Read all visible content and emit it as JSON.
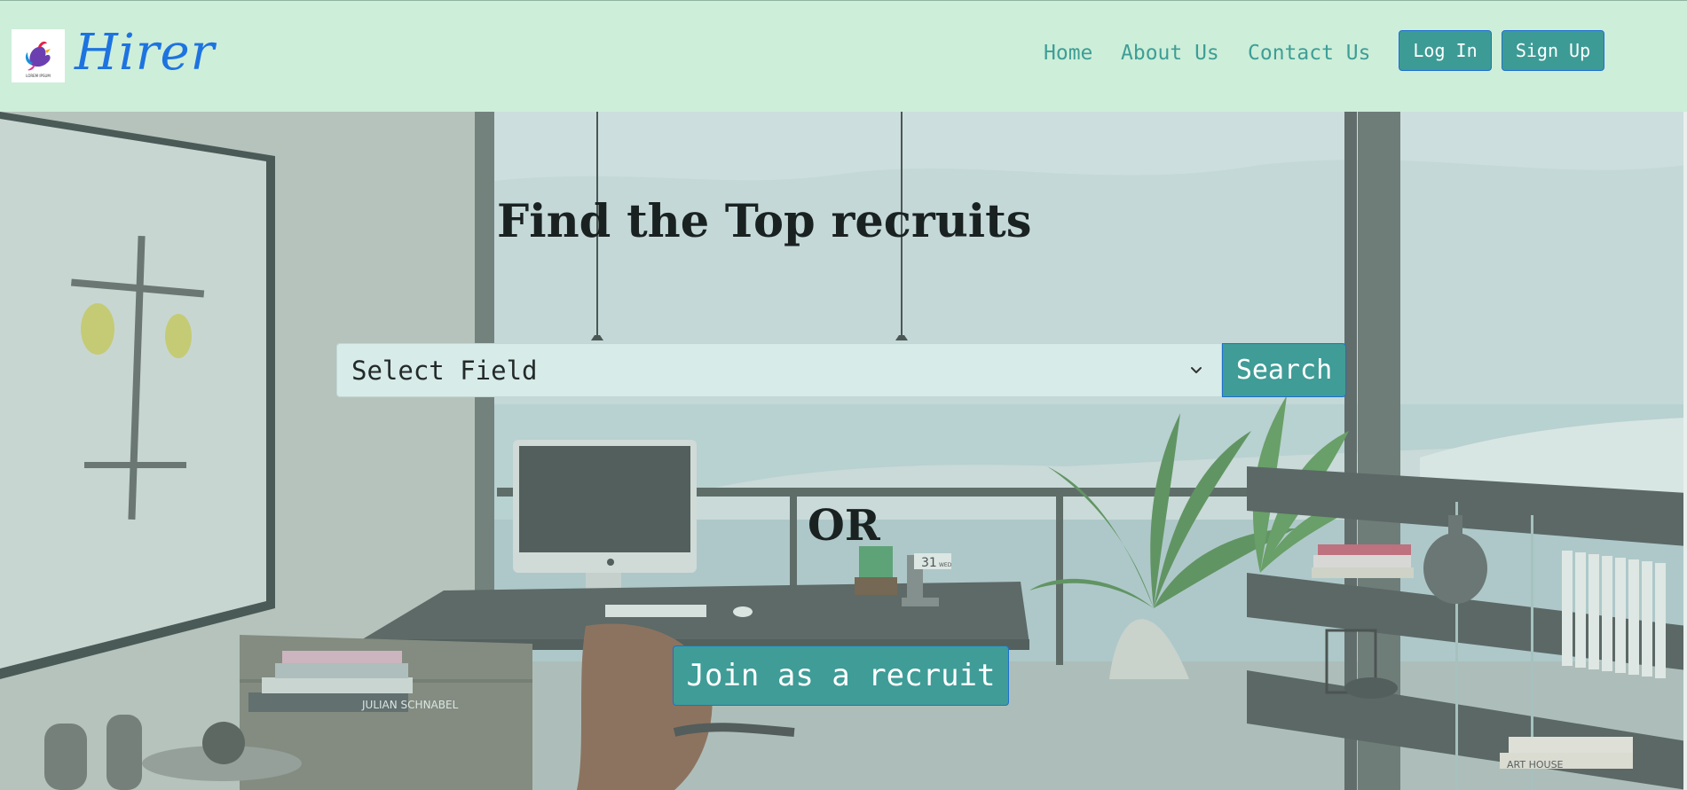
{
  "brand": {
    "name": "Hirer",
    "logo_icon": "rooster-logo-icon",
    "logo_caption": "LOREM IPSUM"
  },
  "nav": {
    "links": [
      {
        "label": "Home"
      },
      {
        "label": "About Us"
      },
      {
        "label": "Contact Us"
      }
    ],
    "login_label": "Log In",
    "signup_label": "Sign Up"
  },
  "hero": {
    "title": "Find the Top recruits",
    "field_select": {
      "selected": "Select Field",
      "icon": "chevron-down-icon"
    },
    "search_label": "Search",
    "or_label": "OR",
    "join_label": "Join as a recruit",
    "background": "office-desk-sea-view-photo",
    "calendar_day": "31",
    "calendar_weekday": "WED",
    "book_title": "JULIAN SCHNABEL",
    "book_title_2": "ART HOUSE"
  },
  "colors": {
    "navbar_bg": "#cdeed9",
    "brand": "#1d73e0",
    "nav_link": "#3e9e96",
    "button_teal": "#3d9b95",
    "button_border": "#1f6fd0",
    "select_bg": "#d7ebe8",
    "heading": "#1a2221"
  }
}
